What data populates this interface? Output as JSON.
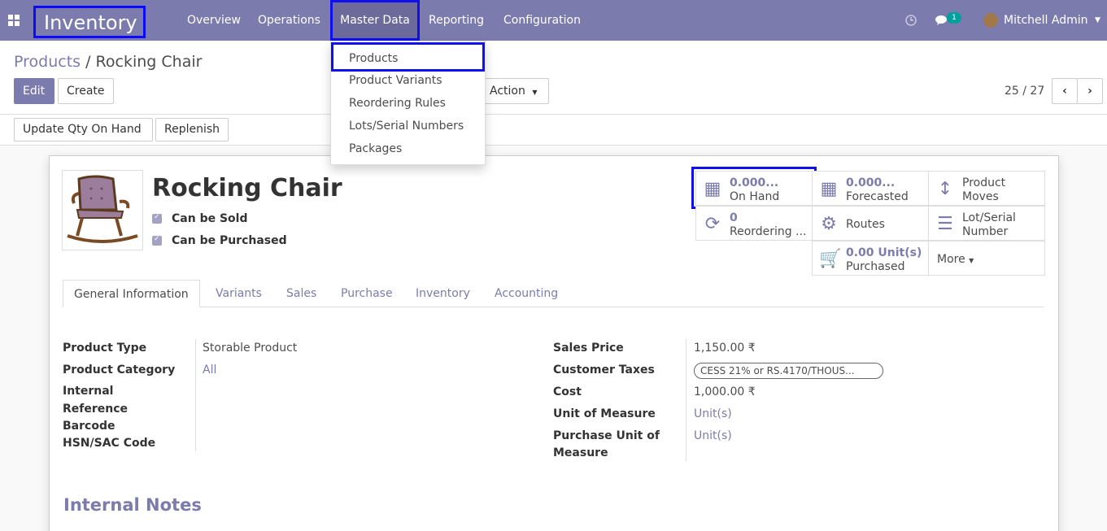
{
  "navbar": {
    "app_title": "Inventory",
    "menus": [
      "Overview",
      "Operations",
      "Master Data",
      "Reporting",
      "Configuration"
    ],
    "message_count": "1",
    "user_name": "Mitchell Admin"
  },
  "master_data_menu": [
    "Products",
    "Product Variants",
    "Reordering Rules",
    "Lots/Serial Numbers",
    "Packages"
  ],
  "breadcrumb": {
    "parent": "Products",
    "separator": "/",
    "current": "Rocking Chair"
  },
  "buttons": {
    "edit": "Edit",
    "create": "Create",
    "action": "Action",
    "update_qty": "Update Qty On Hand",
    "replenish": "Replenish"
  },
  "pager": "25 / 27",
  "product": {
    "name": "Rocking Chair",
    "can_be_sold": "Can be Sold",
    "can_be_purchased": "Can be Purchased"
  },
  "smart_buttons": {
    "on_hand": {
      "value": "0.000...",
      "label": "On Hand"
    },
    "forecasted": {
      "value": "0.000...",
      "label": "Forecasted"
    },
    "moves": {
      "label1": "Product",
      "label2": "Moves"
    },
    "reordering": {
      "value": "0",
      "label": "Reordering ..."
    },
    "routes": {
      "label": "Routes"
    },
    "lots": {
      "label1": "Lot/Serial",
      "label2": "Number"
    },
    "purchased": {
      "value": "0.00",
      "unit": "Unit(s)",
      "label": "Purchased"
    },
    "more": "More"
  },
  "tabs": [
    "General Information",
    "Variants",
    "Sales",
    "Purchase",
    "Inventory",
    "Accounting"
  ],
  "fields_left": {
    "product_type_label": "Product Type",
    "product_type": "Storable Product",
    "category_label": "Product Category",
    "category": "All",
    "internal_ref_label1": "Internal",
    "internal_ref_label2": "Reference",
    "barcode_label": "Barcode",
    "hsn_label": "HSN/SAC Code"
  },
  "fields_right": {
    "sales_price_label": "Sales Price",
    "sales_price": "1,150.00 ₹",
    "taxes_label": "Customer Taxes",
    "taxes": "CESS 21% or RS.4170/THOUS...",
    "cost_label": "Cost",
    "cost": "1,000.00 ₹",
    "uom_label": "Unit of Measure",
    "uom": "Unit(s)",
    "puom_label1": "Purchase Unit of",
    "puom_label2": "Measure",
    "puom": "Unit(s)"
  },
  "notes_title": "Internal Notes"
}
